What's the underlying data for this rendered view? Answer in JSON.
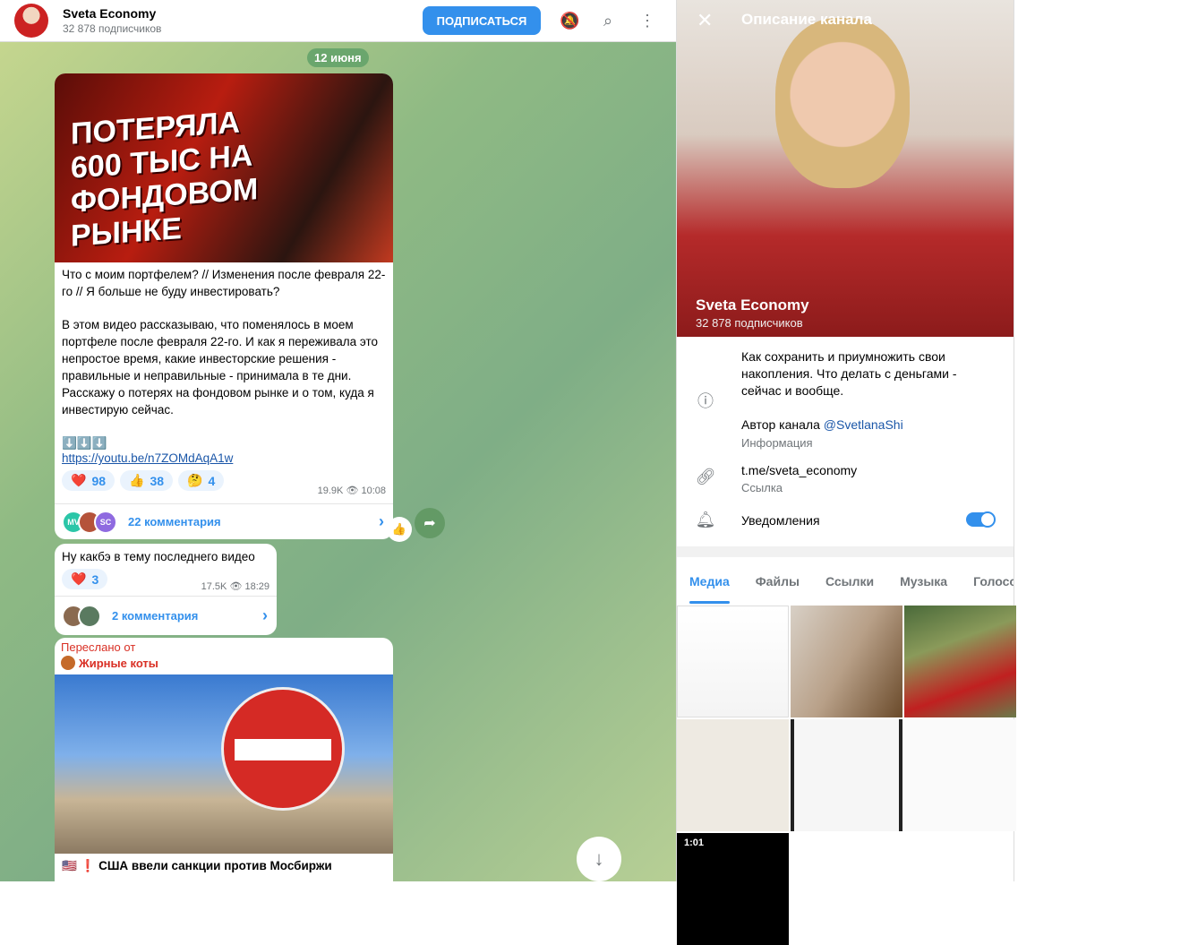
{
  "header": {
    "title": "Sveta Economy",
    "subtitle": "32 878 подписчиков",
    "subscribe": "ПОДПИСАТЬСЯ"
  },
  "date": "12 июня",
  "post1": {
    "thumbnail_text": "ПОТЕРЯЛА 600 ТЫС НА ФОНДОВОМ РЫНКЕ",
    "title": "Что с моим портфелем? // Изменения после февраля 22-го // Я больше не буду инвестировать?",
    "body": "В этом видео рассказываю, что поменялось в моем портфеле после февраля 22-го. И как я переживала это непростое время, какие инвесторские решения - правильные и неправильные - принимала в те дни. Расскажу о потерях на фондовом рынке и о том, куда я инвестирую сейчас.",
    "arrows": "⬇️⬇️⬇️",
    "link": "https://youtu.be/n7ZOMdAqA1w",
    "reactions": [
      {
        "emoji": "❤️",
        "count": "98"
      },
      {
        "emoji": "👍",
        "count": "38"
      },
      {
        "emoji": "🤔",
        "count": "4"
      }
    ],
    "views": "19.9K",
    "time": "10:08",
    "comments": "22 комментария",
    "comment_avatars": [
      "MV",
      "",
      "SC"
    ],
    "quick_reaction": "👍"
  },
  "post2": {
    "text": "Ну какбэ в тему последнего видео",
    "reactions": [
      {
        "emoji": "❤️",
        "count": "3"
      }
    ],
    "views": "17.5K",
    "time": "18:29",
    "comments": "2 комментария"
  },
  "post3": {
    "forwarded_label": "Переслано от",
    "forwarded_from": "Жирные коты",
    "caption": "🇺🇸 ❗ США ввели санкции против Мосбиржи"
  },
  "panel": {
    "title": "Описание канала",
    "name": "Sveta Economy",
    "subscribers": "32 878 подписчиков",
    "description": "Как сохранить и приумножить свои накопления. Что делать с деньгами - сейчас и вообще.",
    "author_prefix": "Автор канала ",
    "author_handle": "@SvetlanaShi",
    "info_label": "Информация",
    "link": "t.me/sveta_economy",
    "link_label": "Ссылка",
    "notifications": "Уведомления",
    "notifications_on": true,
    "tabs": [
      "Медиа",
      "Файлы",
      "Ссылки",
      "Музыка",
      "Голосовые"
    ],
    "video_duration": "1:01"
  },
  "colors": {
    "accent": "#3390ec",
    "forward": "#d93025"
  }
}
